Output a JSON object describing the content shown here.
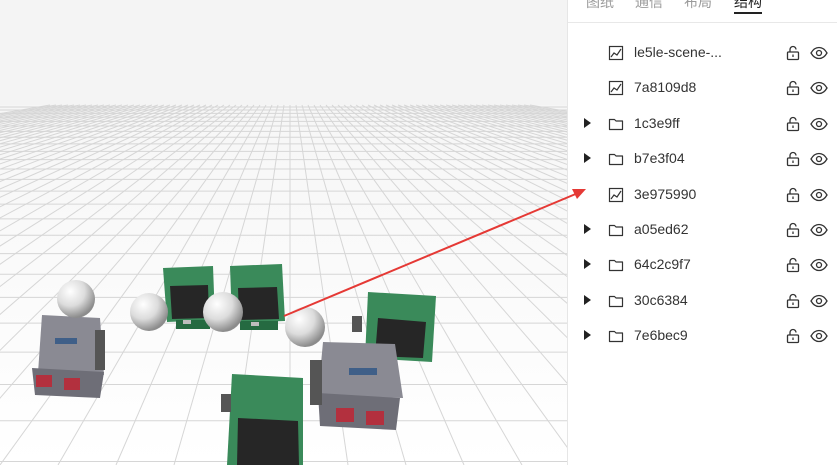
{
  "tabs": [
    {
      "label": "图纸",
      "active": false
    },
    {
      "label": "通信",
      "active": false
    },
    {
      "label": "布局",
      "active": false
    },
    {
      "label": "结构",
      "active": true
    }
  ],
  "tree": [
    {
      "label": "le5le-scene-...",
      "type": "chart",
      "expandable": false
    },
    {
      "label": "7a8109d8",
      "type": "chart",
      "expandable": false
    },
    {
      "label": "1c3e9ff",
      "type": "folder",
      "expandable": true
    },
    {
      "label": "b7e3f04",
      "type": "folder",
      "expandable": true
    },
    {
      "label": "3e975990",
      "type": "chart",
      "expandable": false
    },
    {
      "label": "a05ed62",
      "type": "folder",
      "expandable": true
    },
    {
      "label": "64c2c9f7",
      "type": "folder",
      "expandable": true
    },
    {
      "label": "30c6384",
      "type": "folder",
      "expandable": true
    },
    {
      "label": "7e6bec9",
      "type": "folder",
      "expandable": true
    }
  ],
  "icons": {
    "row_lock": "unlocked-lock-icon",
    "row_visibility": "eye-icon",
    "collapse": "caret-right-icon",
    "group": "folder-icon",
    "scene_item": "line-chart-icon"
  },
  "colors": {
    "arrow": "#e53935",
    "vehicle_green": "#2f7a4f",
    "vehicle_grey": "#7c7c84"
  }
}
